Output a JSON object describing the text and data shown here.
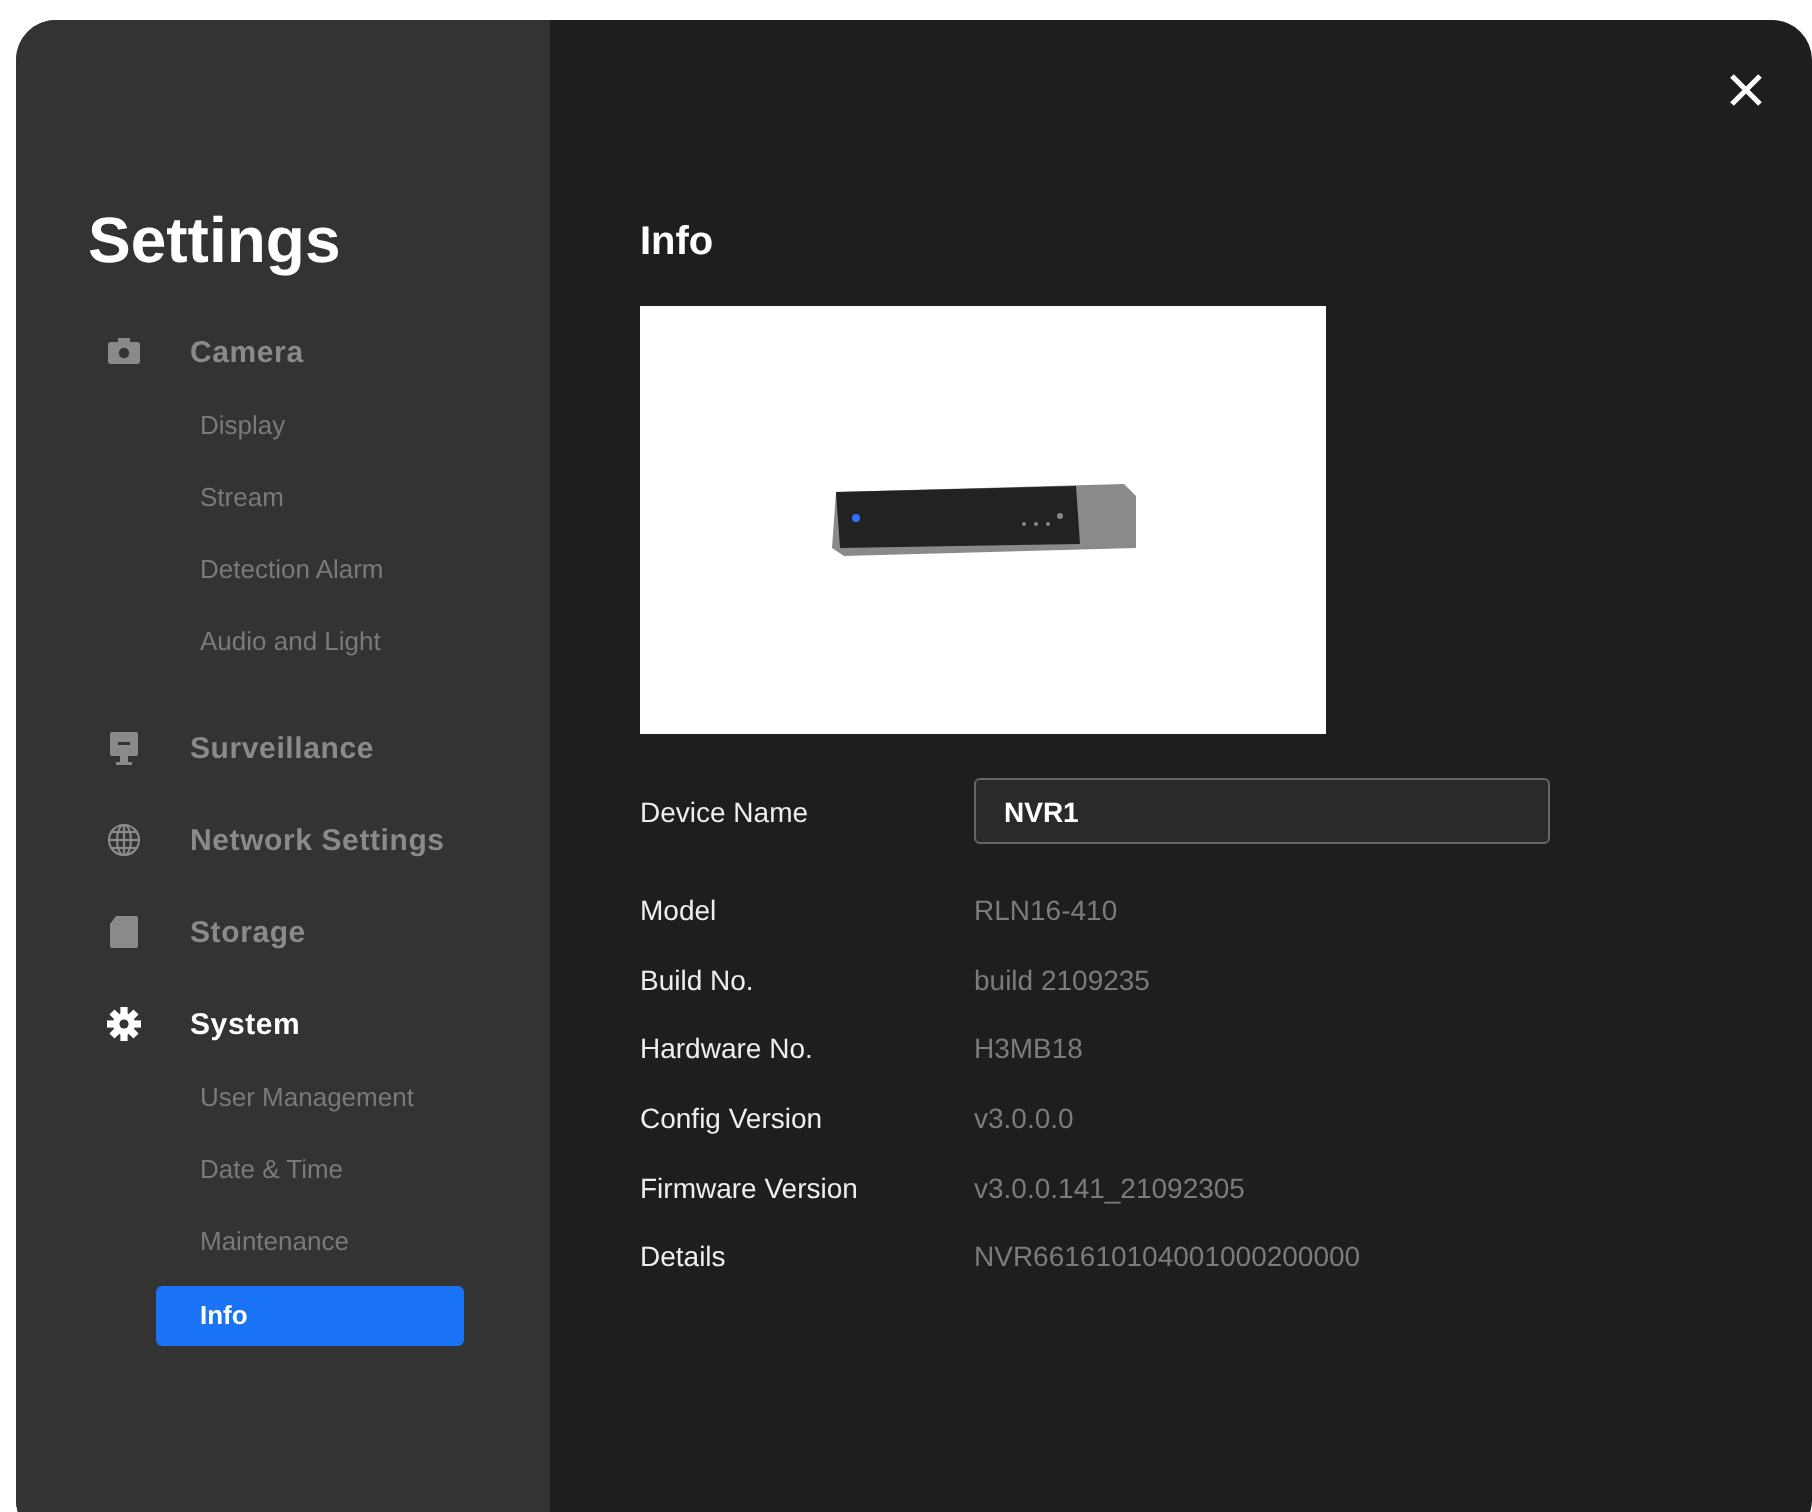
{
  "sidebar": {
    "title": "Settings",
    "groups": [
      {
        "label": "Camera",
        "active": false,
        "children": [
          {
            "label": "Display",
            "selected": false
          },
          {
            "label": "Stream",
            "selected": false
          },
          {
            "label": "Detection Alarm",
            "selected": false
          },
          {
            "label": "Audio and Light",
            "selected": false
          }
        ]
      },
      {
        "label": "Surveillance",
        "active": false
      },
      {
        "label": "Network Settings",
        "active": false
      },
      {
        "label": "Storage",
        "active": false
      },
      {
        "label": "System",
        "active": true,
        "children": [
          {
            "label": "User Management",
            "selected": false
          },
          {
            "label": "Date & Time",
            "selected": false
          },
          {
            "label": "Maintenance",
            "selected": false
          },
          {
            "label": "Info",
            "selected": true
          }
        ]
      }
    ]
  },
  "main": {
    "title": "Info",
    "device_name": {
      "label": "Device Name",
      "value": "NVR1"
    },
    "fields": [
      {
        "label": "Model",
        "value": "RLN16-410"
      },
      {
        "label": "Build No.",
        "value": "build 2109235"
      },
      {
        "label": "Hardware No.",
        "value": "H3MB18"
      },
      {
        "label": "Config Version",
        "value": "v3.0.0.0"
      },
      {
        "label": "Firmware Version",
        "value": "v3.0.0.141_21092305"
      },
      {
        "label": "Details",
        "value": "NVR661610104001000200000"
      }
    ]
  }
}
